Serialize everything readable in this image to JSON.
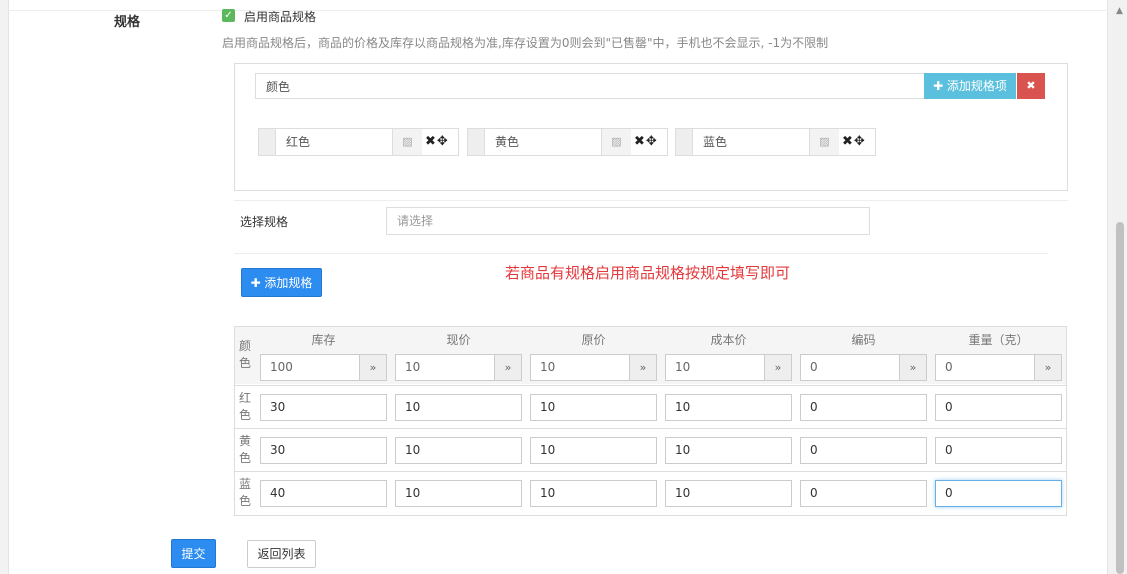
{
  "spec": {
    "label": "规格",
    "enable_label": "启用商品规格",
    "help": "启用商品规格后，商品的价格及库存以商品规格为准,库存设置为0则会到\"已售罄\"中，手机也不会显示, -1为不限制",
    "group_name": "颜色",
    "add_item_label": "✚ 添加规格项",
    "delete_label": "✖",
    "items": [
      {
        "name": "红色"
      },
      {
        "name": "黄色"
      },
      {
        "name": "蓝色"
      }
    ],
    "select_label": "选择规格",
    "select_placeholder": "请选择",
    "add_spec_label": "✚ 添加规格",
    "note": "若商品有规格启用商品规格按规定填写即可"
  },
  "table": {
    "corner": "颜\n色",
    "columns": [
      "库存",
      "现价",
      "原价",
      "成本价",
      "编码",
      "重量（克）"
    ],
    "batch_values": [
      "100",
      "10",
      "10",
      "10",
      "0",
      "0"
    ],
    "rows": [
      {
        "label": "红\n色",
        "values": [
          "30",
          "10",
          "10",
          "10",
          "0",
          "0"
        ]
      },
      {
        "label": "黄\n色",
        "values": [
          "30",
          "10",
          "10",
          "10",
          "0",
          "0"
        ]
      },
      {
        "label": "蓝\n色",
        "values": [
          "40",
          "10",
          "10",
          "10",
          "0",
          "0"
        ]
      }
    ]
  },
  "actions": {
    "submit_label": "提交",
    "back_label": "返回列表"
  },
  "icons": {
    "checkbox": "check-icon",
    "image": "image-picker-icon",
    "remove": "times-icon",
    "move": "move-arrows-icon",
    "batch": "double-chevron-down-icon"
  },
  "colors": {
    "primary": "#2d8cf0",
    "info": "#5bc0de",
    "danger": "#d9534f",
    "note": "#e4393c",
    "success": "#5cb85c"
  }
}
